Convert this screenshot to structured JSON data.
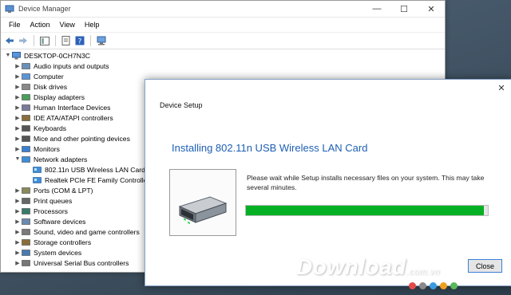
{
  "device_manager": {
    "title": "Device Manager",
    "menu": [
      "File",
      "Action",
      "View",
      "Help"
    ],
    "computer_name": "DESKTOP-0CH7N3C",
    "categories": [
      {
        "label": "Audio inputs and outputs",
        "icon": "speaker-icon",
        "expanded": false
      },
      {
        "label": "Computer",
        "icon": "computer-icon",
        "expanded": false
      },
      {
        "label": "Disk drives",
        "icon": "disk-drive-icon",
        "expanded": false
      },
      {
        "label": "Display adapters",
        "icon": "display-adapter-icon",
        "expanded": false
      },
      {
        "label": "Human Interface Devices",
        "icon": "hid-icon",
        "expanded": false
      },
      {
        "label": "IDE ATA/ATAPI controllers",
        "icon": "ide-controller-icon",
        "expanded": false
      },
      {
        "label": "Keyboards",
        "icon": "keyboard-icon",
        "expanded": false
      },
      {
        "label": "Mice and other pointing devices",
        "icon": "mouse-icon",
        "expanded": false
      },
      {
        "label": "Monitors",
        "icon": "monitor-icon",
        "expanded": false
      },
      {
        "label": "Network adapters",
        "icon": "network-adapter-icon",
        "expanded": true,
        "children": [
          "802.11n USB Wireless LAN Card",
          "Realtek PCIe FE Family Controller"
        ]
      },
      {
        "label": "Ports (COM & LPT)",
        "icon": "port-icon",
        "expanded": false
      },
      {
        "label": "Print queues",
        "icon": "printer-icon",
        "expanded": false
      },
      {
        "label": "Processors",
        "icon": "processor-icon",
        "expanded": false
      },
      {
        "label": "Software devices",
        "icon": "software-device-icon",
        "expanded": false
      },
      {
        "label": "Sound, video and game controllers",
        "icon": "sound-icon",
        "expanded": false
      },
      {
        "label": "Storage controllers",
        "icon": "storage-controller-icon",
        "expanded": false
      },
      {
        "label": "System devices",
        "icon": "system-device-icon",
        "expanded": false
      },
      {
        "label": "Universal Serial Bus controllers",
        "icon": "usb-icon",
        "expanded": false
      }
    ]
  },
  "device_setup": {
    "caption": "Device Setup",
    "heading": "Installing 802.11n USB Wireless LAN Card",
    "message": "Please wait while Setup installs necessary files on your system. This may take several minutes.",
    "progress_fraction": 0.985,
    "close_label": "Close"
  },
  "watermark": {
    "text": "Download",
    "suffix": ".com.vn"
  },
  "colors": {
    "accent": "#1d5fb4",
    "progress": "#06b025"
  }
}
